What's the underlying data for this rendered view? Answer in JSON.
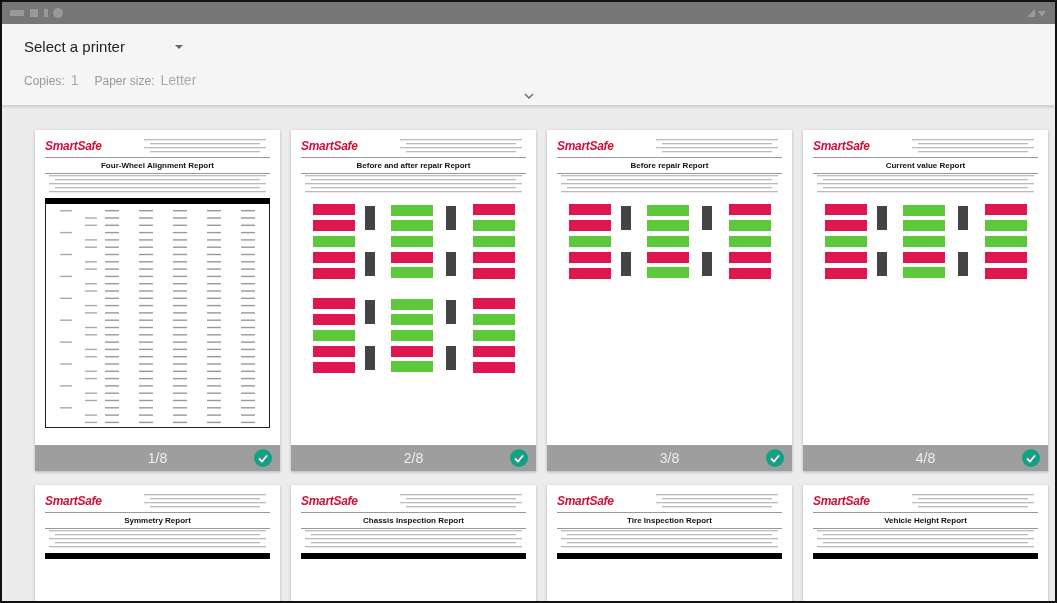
{
  "printer": {
    "label": "Select a printer"
  },
  "options": [
    {
      "label": "Copies:",
      "value": "1"
    },
    {
      "label": "Paper size:",
      "value": "Letter"
    }
  ],
  "pages": [
    {
      "number": "1/8",
      "selected": true,
      "logo": "SmartSafe",
      "title": "Four-Wheel Alignment Report",
      "kind": "table"
    },
    {
      "number": "2/8",
      "selected": true,
      "logo": "SmartSafe",
      "title": "Before and after repair Report",
      "kind": "double"
    },
    {
      "number": "3/8",
      "selected": true,
      "logo": "SmartSafe",
      "title": "Before repair Report",
      "kind": "single"
    },
    {
      "number": "4/8",
      "selected": true,
      "logo": "SmartSafe",
      "title": "Current value Report",
      "kind": "single"
    },
    {
      "logo": "SmartSafe",
      "title": "Symmetry Report",
      "kind": "blank"
    },
    {
      "logo": "SmartSafe",
      "title": "Chassis Inspection Report",
      "kind": "blank"
    },
    {
      "logo": "SmartSafe",
      "title": "Tire Inspection Report",
      "kind": "blank"
    },
    {
      "logo": "SmartSafe",
      "title": "Vehicle Height Report",
      "kind": "blank"
    }
  ]
}
